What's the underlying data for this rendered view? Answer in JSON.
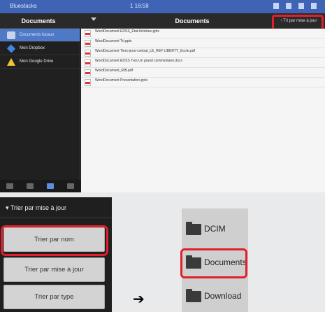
{
  "statusbar": {
    "brand": "Bluestacks",
    "center": "1 16:58"
  },
  "appbar": {
    "left_title": "Documents",
    "center_title": "Documents",
    "sort_action": "↑ Tri par mise à jour"
  },
  "sidebar": {
    "items": [
      {
        "label": "Documents locaux",
        "icon": "tablet-icon"
      },
      {
        "label": "Mon Dropbox",
        "icon": "dropbox-icon"
      },
      {
        "label": "Mon Google Drive",
        "icon": "google-drive-icon"
      }
    ]
  },
  "files": [
    {
      "name": "WordDocument EDSS_Etat Activites.pptx",
      "meta": ""
    },
    {
      "name": "WordDocument Tri.pptx",
      "meta": ""
    },
    {
      "name": "WordDocument Tiers-pour-contrat_LE_REF LIBERTY_Ecole.pdf",
      "meta": ""
    },
    {
      "name": "WordDocument EDSS Tres Un grand commentaire.docx",
      "meta": ""
    },
    {
      "name": "WordDocument_RIB.pdf",
      "meta": ""
    },
    {
      "name": "WordDocument Presentation.pptx",
      "meta": ""
    }
  ],
  "sort_menu": {
    "header": "▾ Trier par mise à jour",
    "options": [
      "Trier par nom",
      "Trier par mise à jour",
      "Trier par type"
    ]
  },
  "arrow": "➔",
  "folders": [
    "DCIM",
    "Documents",
    "Download"
  ],
  "colors": {
    "highlight_red": "#e0202a",
    "statusbar_blue": "#3f63b5",
    "sidebar_active": "#4d79c7"
  }
}
